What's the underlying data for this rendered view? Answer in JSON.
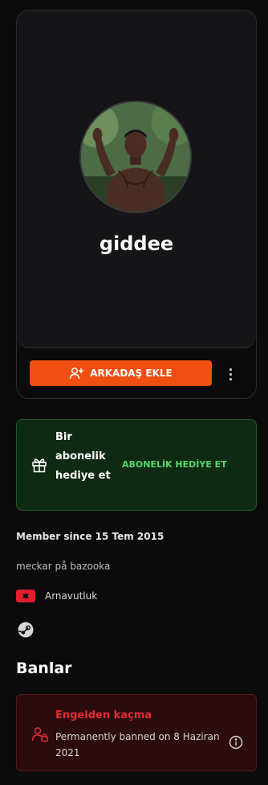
{
  "profile": {
    "username": "giddee",
    "add_friend_label": "ARKADAŞ EKLE"
  },
  "gift": {
    "text": "Bir abonelik hediye et",
    "action_label": "ABONELİK HEDİYE ET"
  },
  "about": {
    "member_since": "Member since 15 Tem 2015",
    "bio": "meckar på bazooka",
    "country": "Arnavutluk"
  },
  "bans": {
    "title": "Banlar",
    "items": [
      {
        "title": "Engelden kaçma",
        "detail": "Permanently banned on 8 Haziran 2021"
      }
    ]
  },
  "colors": {
    "accent": "#f04e12",
    "gift_bg": "#0e2a13",
    "gift_accent": "#53d86a",
    "ban_bg": "#2c0b0e",
    "ban_accent": "#e22b33"
  },
  "icons": [
    "add-user-icon",
    "more-vertical-icon",
    "gift-icon",
    "albania-flag-icon",
    "steam-icon",
    "banned-user-icon",
    "info-icon"
  ]
}
